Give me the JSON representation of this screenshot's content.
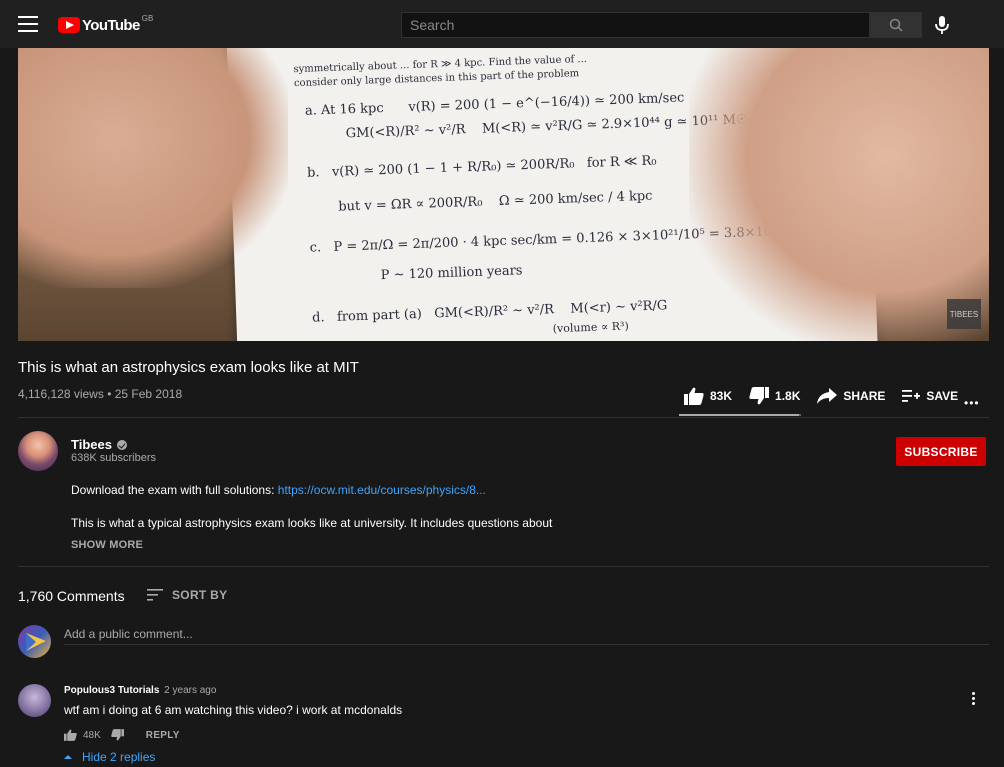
{
  "header": {
    "logo_text": "YouTube",
    "logo_country": "GB",
    "search_placeholder": "Search"
  },
  "video": {
    "watermark": "TIBEES",
    "title": "This is what an astrophysics exam looks like at MIT",
    "views": "4,116,128 views",
    "date": "25 Feb 2018",
    "likes": "83K",
    "dislikes": "1.8K",
    "share_label": "SHARE",
    "save_label": "SAVE",
    "like_ratio": 0.98
  },
  "channel": {
    "name": "Tibees",
    "subscribers": "638K subscribers",
    "subscribe_label": "SUBSCRIBE"
  },
  "description": {
    "line1_prefix": "Download the exam with full solutions: ",
    "line1_link": "https://ocw.mit.edu/courses/physics/8...",
    "line2": "This is what a typical astrophysics exam looks like at university. It includes questions about",
    "show_more": "SHOW MORE"
  },
  "comments": {
    "count": "1,760 Comments",
    "sort_label": "SORT BY",
    "add_placeholder": "Add a public comment...",
    "items": [
      {
        "author": "Populous3 Tutorials",
        "time": "2 years ago",
        "text": "wtf am i doing at 6 am watching this video? i work at mcdonalds",
        "likes": "48K",
        "reply_label": "REPLY",
        "hide_replies": "Hide 2 replies"
      }
    ]
  },
  "colors": {
    "background": "#181818",
    "topbar": "#202020",
    "subscribe": "#cc0000",
    "link": "#3ea6ff",
    "brand_red": "#ff0000"
  }
}
